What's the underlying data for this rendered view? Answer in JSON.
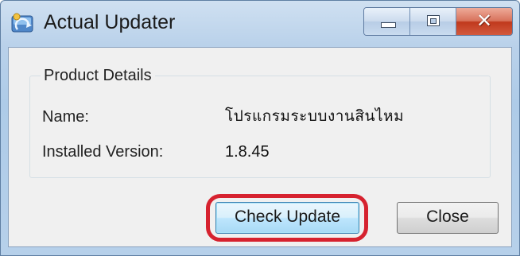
{
  "window": {
    "title": "Actual Updater",
    "app_icon": "updater-app-icon",
    "controls": {
      "minimize_icon": "minimize-icon",
      "maximize_icon": "maximize-icon",
      "close_icon": "close-icon",
      "close_glyph": "✕"
    }
  },
  "product_details": {
    "group_title": "Product Details",
    "name_label": "Name:",
    "name_value": "โปรแกรมระบบงานสินไหม",
    "version_label": "Installed Version:",
    "version_value": "1.8.45"
  },
  "buttons": {
    "check_update_label": "Check Update",
    "close_label": "Close"
  },
  "colors": {
    "highlight_outline": "#d6222f",
    "close_button_red": "#c0391c",
    "titlebar_blue": "#b9d1ea"
  }
}
